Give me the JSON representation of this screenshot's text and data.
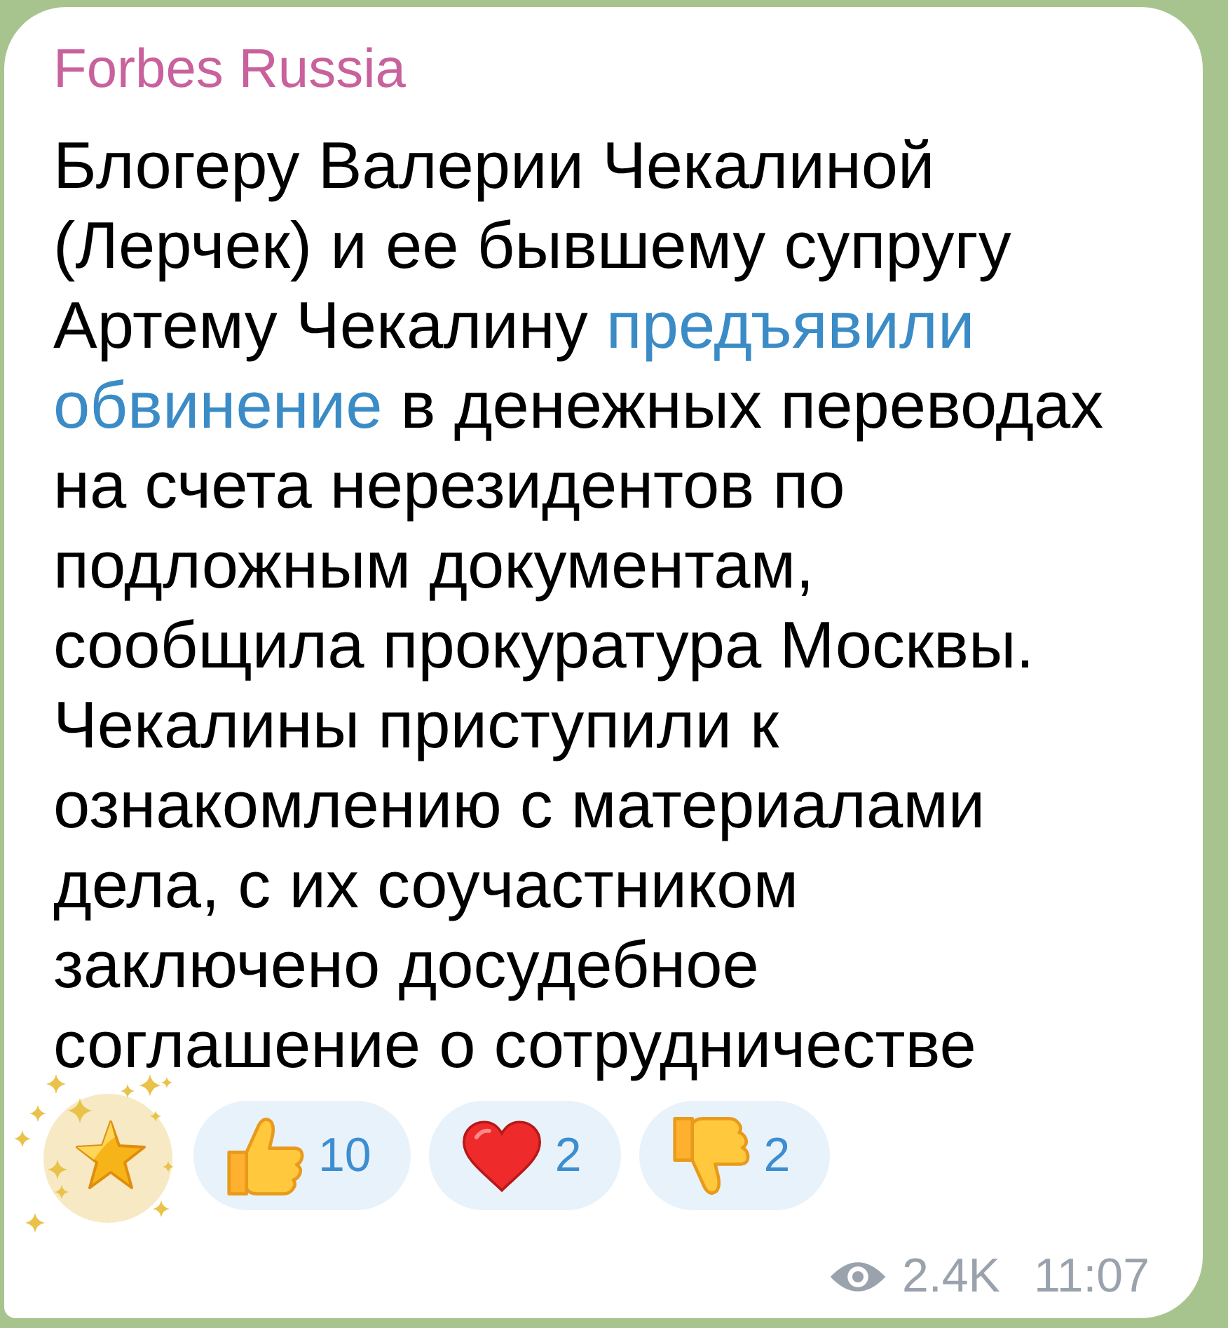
{
  "channel": {
    "name": "Forbes Russia"
  },
  "message": {
    "parts": [
      {
        "kind": "text",
        "text": "Блогеру Валерии Чекалиной (Лерчек) и ее бывшему супругу Артему Чекалину"
      },
      {
        "kind": "link",
        "text": "предъявили"
      },
      {
        "kind": "link",
        "text": "обвинение"
      },
      {
        "kind": "text",
        "text": "в денежных переводах на счета нерезидентов по подложным документам, сообщила прокуратура Москвы. Чекалины приступили к ознакомлению с материалами дела, с их соучастником заключено досудебное соглашение о сотрудничестве"
      }
    ]
  },
  "reactions": [
    {
      "kind": "star",
      "selected": false
    },
    {
      "kind": "thumbs_up",
      "count": "10",
      "selected": false
    },
    {
      "kind": "heart",
      "count": "2",
      "selected": false
    },
    {
      "kind": "thumbs_down",
      "count": "2",
      "selected": false
    }
  ],
  "footer": {
    "views": "2.4K",
    "time": "11:07"
  }
}
